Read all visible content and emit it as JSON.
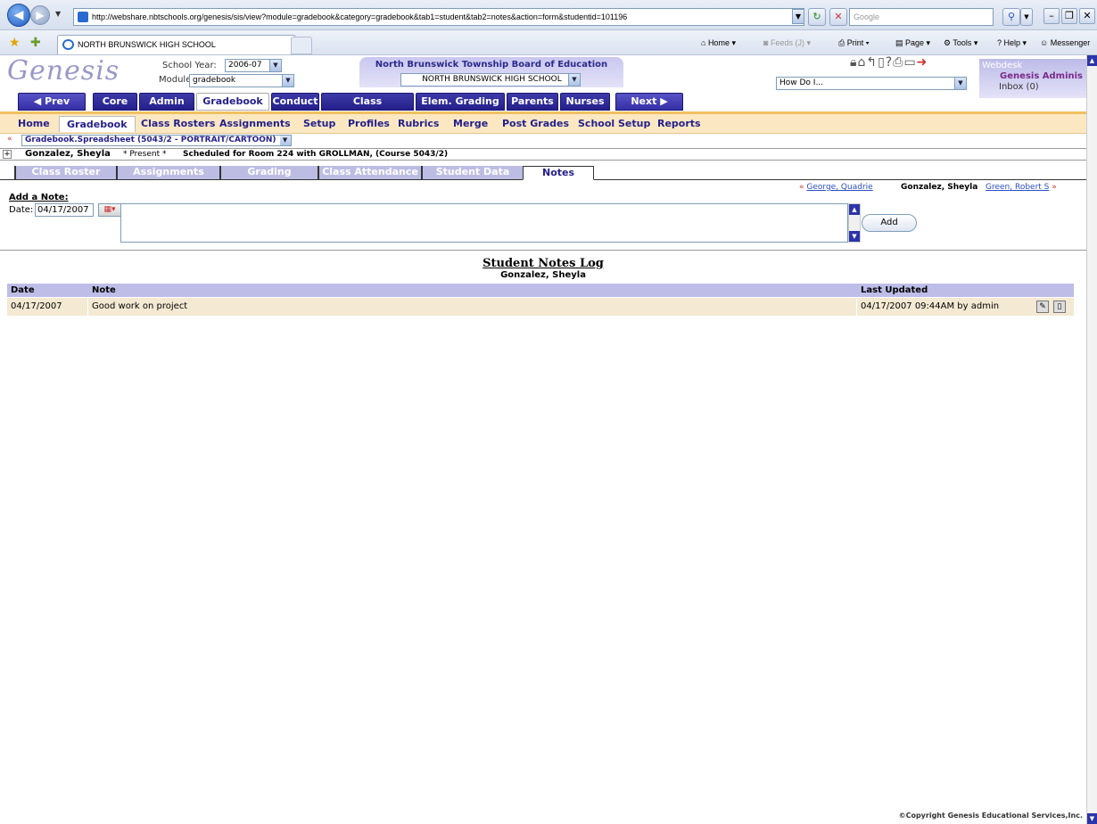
{
  "browser": {
    "url": "http://webshare.nbtschools.org/genesis/sis/view?module=gradebook&category=gradebook&tab1=student&tab2=notes&action=form&studentid=101196",
    "search_placeholder": "Google",
    "tab_title": "NORTH BRUNSWICK HIGH SCHOOL",
    "commands": {
      "home": "Home",
      "feeds": "Feeds (J)",
      "print": "Print",
      "page": "Page",
      "tools": "Tools",
      "help": "Help",
      "messenger": "Messenger"
    }
  },
  "header": {
    "logo": "Genesis",
    "school_year_label": "School Year:",
    "school_year": "2006-07",
    "module_label": "Module:",
    "module": "gradebook",
    "board": "North Brunswick Township Board of Education",
    "school": "NORTH BRUNSWICK HIGH SCHOOL",
    "how_do_i": "How Do I...",
    "webdesk_label": "Webdesk",
    "webdesk_user": "Genesis Adminis",
    "inbox": "Inbox (0)"
  },
  "module_tabs": {
    "prev": "◀ Prev",
    "core": "Core",
    "admin": "Admin",
    "gradebook": "Gradebook",
    "conduct": "Conduct",
    "class_attendance": "Class Attendance",
    "elem_grading": "Elem. Grading",
    "parents": "Parents",
    "nurses": "Nurses",
    "next": "Next ▶"
  },
  "sub_menu": {
    "home": "Home",
    "gradebook": "Gradebook",
    "class_rosters": "Class Rosters",
    "assignments": "Assignments",
    "setup": "Setup",
    "profiles": "Profiles",
    "rubrics": "Rubrics",
    "merge": "Merge",
    "post_grades": "Post Grades",
    "school_setup": "School Setup",
    "reports": "Reports"
  },
  "crumb": "Gradebook.Spreadsheet (5043/2 - PORTRAIT/CARTOON)",
  "student": {
    "name": "Gonzalez, Sheyla",
    "status": "* Present *",
    "schedule": "Scheduled for Room 224 with GROLLMAN, (Course 5043/2)"
  },
  "student_tabs": {
    "class_roster": "Class Roster",
    "assignments": "Assignments",
    "grading": "Grading",
    "class_attendance": "Class Attendance",
    "student_data": "Student Data",
    "notes": "Notes"
  },
  "student_nav": {
    "prev": "George, Quadrie",
    "current": "Gonzalez, Sheyla",
    "next": "Green, Robert S"
  },
  "add_note": {
    "title": "Add a Note:",
    "date_label": "Date:",
    "date_value": "04/17/2007",
    "add_button": "Add"
  },
  "log": {
    "title": "Student Notes Log",
    "student": "Gonzalez, Sheyla",
    "headers": {
      "date": "Date",
      "note": "Note",
      "last_updated": "Last Updated"
    },
    "rows": [
      {
        "date": "04/17/2007",
        "note": "Good work on project",
        "last_updated": "04/17/2007 09:44AM by admin"
      }
    ]
  },
  "footer": "©Copyright Genesis Educational Services,Inc."
}
